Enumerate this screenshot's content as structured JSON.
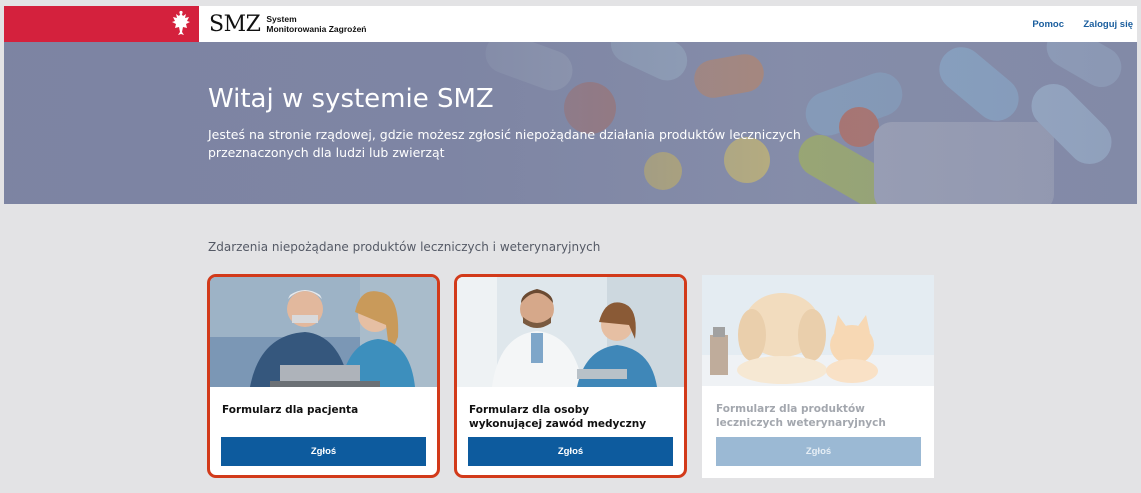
{
  "header": {
    "brand_name": "SMZ",
    "brand_sub_line1": "System",
    "brand_sub_line2": "Monitorowania Zagrożeń",
    "nav_help": "Pomoc",
    "nav_login": "Zaloguj się"
  },
  "hero": {
    "title": "Witaj w systemie SMZ",
    "subtitle": "Jesteś na stronie rządowej, gdzie możesz zgłosić niepożądane działania produktów leczniczych przeznaczonych dla ludzi lub zwierząt"
  },
  "section": {
    "title": "Zdarzenia niepożądane produktów leczniczych i weterynaryjnych"
  },
  "cards": [
    {
      "label": "Formularz dla pacjenta",
      "button": "Zgłoś",
      "image": "patient-photo"
    },
    {
      "label_line1": "Formularz dla osoby",
      "label_line2": "wykonującej zawód medyczny",
      "button": "Zgłoś",
      "image": "medical-staff-photo"
    },
    {
      "label_line1": "Formularz dla produktów",
      "label_line2": "leczniczych weterynaryjnych",
      "button": "Zgłoś",
      "image": "dog-and-cat-photo"
    }
  ],
  "colors": {
    "flag_red": "#d4213d",
    "primary_blue": "#0d5b9e",
    "highlight_border": "#d23a1a"
  }
}
